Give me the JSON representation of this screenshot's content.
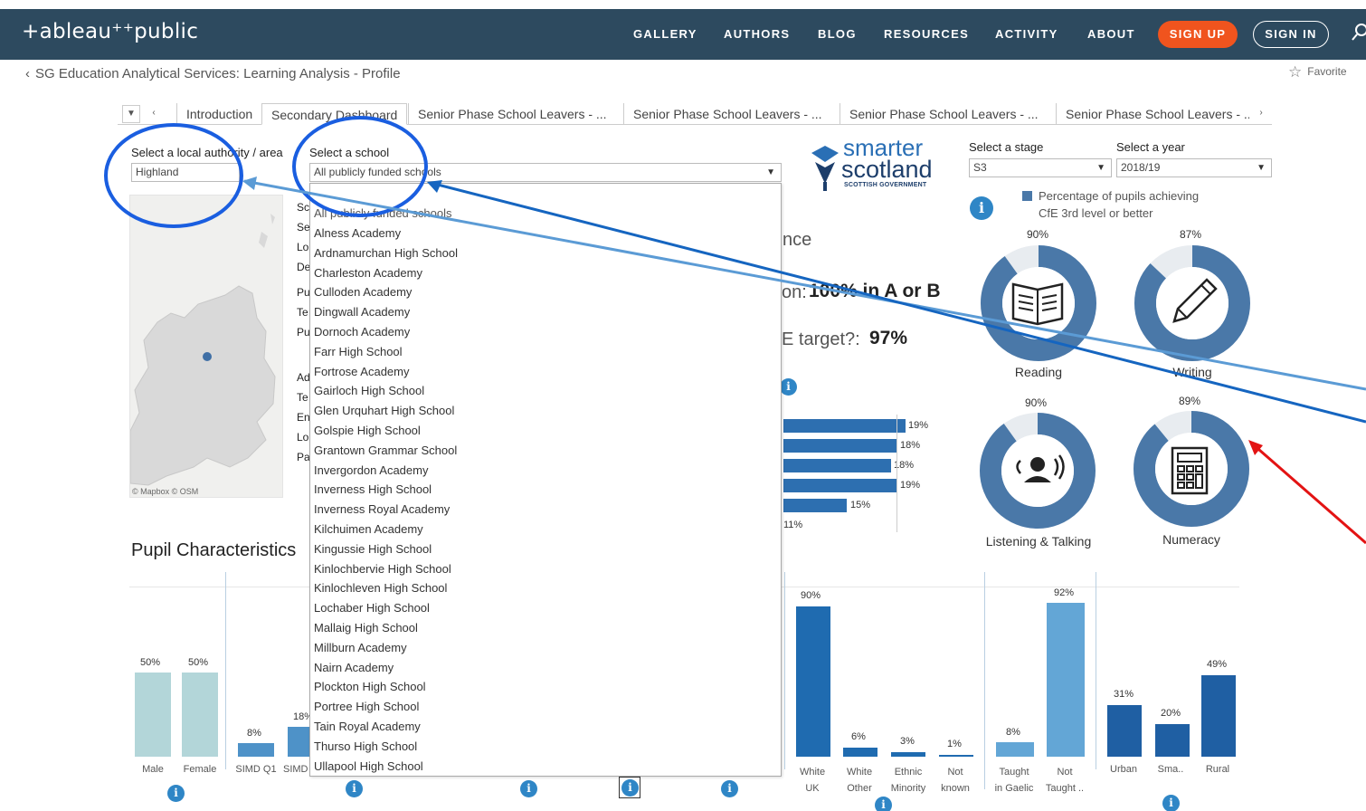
{
  "nav": {
    "logo": "+ableau⁺⁺public",
    "links": [
      "GALLERY",
      "AUTHORS",
      "BLOG",
      "RESOURCES",
      "ACTIVITY",
      "ABOUT"
    ],
    "signup": "SIGN UP",
    "signin": "SIGN IN"
  },
  "breadcrumb": "SG Education Analytical Services: Learning Analysis - Profile",
  "favorite": "Favorite",
  "tabs": [
    "Introduction",
    "Secondary Dashboard",
    "Senior Phase School Leavers - ...",
    "Senior Phase School Leavers - ...",
    "Senior Phase School Leavers - ...",
    "Senior Phase School Leavers - ..."
  ],
  "filters": {
    "la_label": "Select a local authority / area",
    "la_value": "Highland",
    "school_label": "Select a school",
    "school_value": "All publicly funded schools",
    "stage_label": "Select a stage",
    "stage_value": "S3",
    "year_label": "Select a year",
    "year_value": "2018/19"
  },
  "left_labels": [
    "Sc",
    "Se",
    "Lo",
    "De",
    "Pu",
    "Te",
    "Pu",
    "Ad",
    "Te",
    "En",
    "Lo",
    "Pa"
  ],
  "map_credit": "© Mapbox  © OSM",
  "dropdown_items": [
    "All publicly funded schools",
    "Alness Academy",
    "Ardnamurchan High School",
    "Charleston Academy",
    "Culloden Academy",
    "Dingwall Academy",
    "Dornoch Academy",
    "Farr High School",
    "Fortrose Academy",
    "Gairloch High School",
    "Glen Urquhart High School",
    "Golspie High School",
    "Grantown Grammar School",
    "Invergordon Academy",
    "Inverness High School",
    "Inverness Royal Academy",
    "Kilchuimen Academy",
    "Kingussie High School",
    "Kinlochbervie High School",
    "Kinlochleven High School",
    "Lochaber High School",
    "Mallaig High School",
    "Millburn Academy",
    "Nairn Academy",
    "Plockton High School",
    "Portree High School",
    "Tain Royal Academy",
    "Thurso High School",
    "Ullapool High School"
  ],
  "middle": {
    "nce": "nce",
    "on_label": "on:",
    "on_value": "100% in A or B",
    "target_label": "E target?:",
    "target_value": "97%",
    "bar_values": [
      "19%",
      "18%",
      "18%",
      "19%",
      "15%",
      "11%"
    ]
  },
  "brand": {
    "line1": "smarter",
    "line2": "scotland",
    "line3": "SCOTTISH GOVERNMENT"
  },
  "legend": {
    "line1": "Percentage of pupils achieving",
    "line2": "CfE 3rd level or better"
  },
  "donuts": [
    {
      "label": "Reading",
      "pct": "90%",
      "value": 0.9
    },
    {
      "label": "Writing",
      "pct": "87%",
      "value": 0.87
    },
    {
      "label": "Listening & Talking",
      "pct": "90%",
      "value": 0.9
    },
    {
      "label": "Numeracy",
      "pct": "89%",
      "value": 0.89
    }
  ],
  "pupil_title": "Pupil Characteristics",
  "pupil": {
    "gender": {
      "values": [
        "50%",
        "50%"
      ],
      "cats": [
        "Male",
        "Female"
      ]
    },
    "simd": {
      "values": [
        "8%",
        "18%"
      ],
      "cats": [
        "SIMD Q1",
        "SIMD"
      ]
    },
    "ethnic": {
      "values": [
        "90%",
        "6%",
        "3%",
        "1%"
      ],
      "cats": [
        [
          "White",
          "UK"
        ],
        [
          "White",
          "Other"
        ],
        [
          "Ethnic",
          "Minority"
        ],
        [
          "Not",
          "known"
        ]
      ]
    },
    "gaelic": {
      "values": [
        "8%",
        "92%"
      ],
      "cats": [
        [
          "Taught",
          "in Gaelic"
        ],
        [
          "Not",
          "Taught .."
        ]
      ]
    },
    "urban": {
      "values": [
        "31%",
        "20%",
        "49%"
      ],
      "cats": [
        "Urban",
        "Sma..",
        "Rural"
      ]
    }
  },
  "colors": {
    "nav": "#2d4a5f",
    "signup": "#f0541e",
    "donut": "#4a78a8",
    "bar": "#2d6fb0",
    "annot_circle": "#1a5ee0",
    "arrow_red": "#e31313"
  }
}
